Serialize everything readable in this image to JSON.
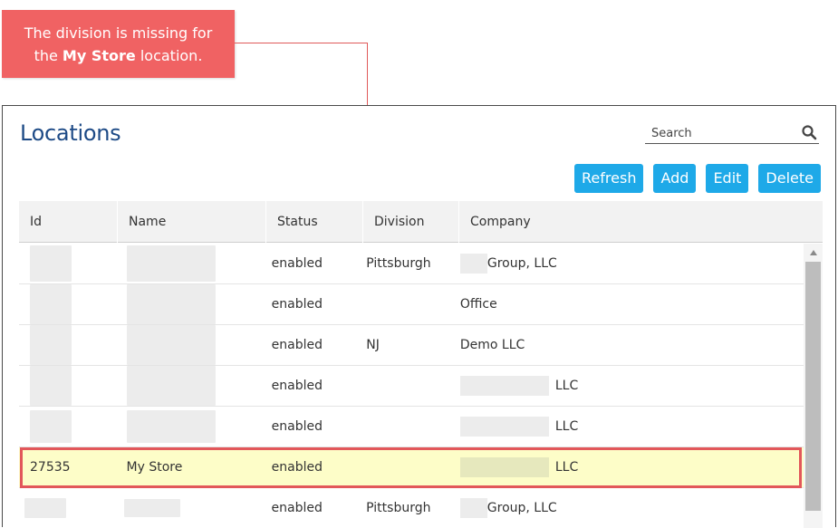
{
  "callout": {
    "line1": "The division is missing for",
    "pre": "the ",
    "bold": "My Store",
    "post": " location."
  },
  "panel": {
    "title": "Locations",
    "search_placeholder": "Search",
    "search_value": ""
  },
  "toolbar": {
    "refresh": "Refresh",
    "add": "Add",
    "edit": "Edit",
    "delete": "Delete"
  },
  "table": {
    "columns": [
      "Id",
      "Name",
      "Status",
      "Division",
      "Company"
    ],
    "rows": [
      {
        "id": "",
        "name": "",
        "status": "enabled",
        "division": "Pittsburgh",
        "company": "Group, LLC"
      },
      {
        "id": "",
        "name": "",
        "status": "enabled",
        "division": "",
        "company": "Office"
      },
      {
        "id": "",
        "name": "",
        "status": "enabled",
        "division": "NJ",
        "company": "Demo LLC"
      },
      {
        "id": "",
        "name": "",
        "status": "enabled",
        "division": "",
        "company": "LLC"
      },
      {
        "id": "",
        "name": "",
        "status": "enabled",
        "division": "",
        "company": "LLC"
      },
      {
        "id": "27535",
        "name": "My Store",
        "status": "enabled",
        "division": "",
        "company": "LLC"
      },
      {
        "id": "",
        "name": "",
        "status": "enabled",
        "division": "Pittsburgh",
        "company": "Group, LLC"
      }
    ],
    "selected_row": 5
  },
  "colors": {
    "accent": "#1ea9e8",
    "title": "#1d4a86",
    "callout": "#f06263",
    "highlight_row": "#fdfdc8",
    "highlight_border": "#e2575a"
  },
  "icons": {
    "search": "search-icon",
    "scroll_up": "chevron-up-icon"
  }
}
